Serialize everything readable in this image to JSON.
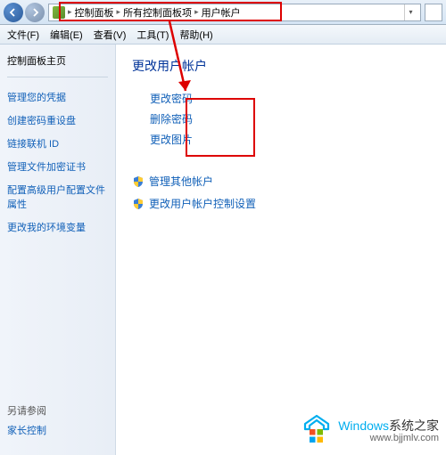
{
  "breadcrumb": {
    "items": [
      "控制面板",
      "所有控制面板项",
      "用户帐户"
    ],
    "sep": "▸"
  },
  "menubar": {
    "file": "文件(F)",
    "edit": "编辑(E)",
    "view": "查看(V)",
    "tools": "工具(T)",
    "help": "帮助(H)"
  },
  "sidebar": {
    "home": "控制面板主页",
    "links": [
      "管理您的凭据",
      "创建密码重设盘",
      "链接联机 ID",
      "管理文件加密证书",
      "配置高级用户配置文件属性",
      "更改我的环境变量"
    ],
    "see_also_title": "另请参阅",
    "see_also_links": [
      "家长控制"
    ]
  },
  "main": {
    "title": "更改用户帐户",
    "actions": [
      "更改密码",
      "删除密码",
      "更改图片"
    ],
    "shield_links": [
      "管理其他帐户",
      "更改用户帐户控制设置"
    ]
  },
  "watermark": {
    "brand": "Windows",
    "suffix": "系统之家",
    "url": "www.bjjmlv.com"
  }
}
